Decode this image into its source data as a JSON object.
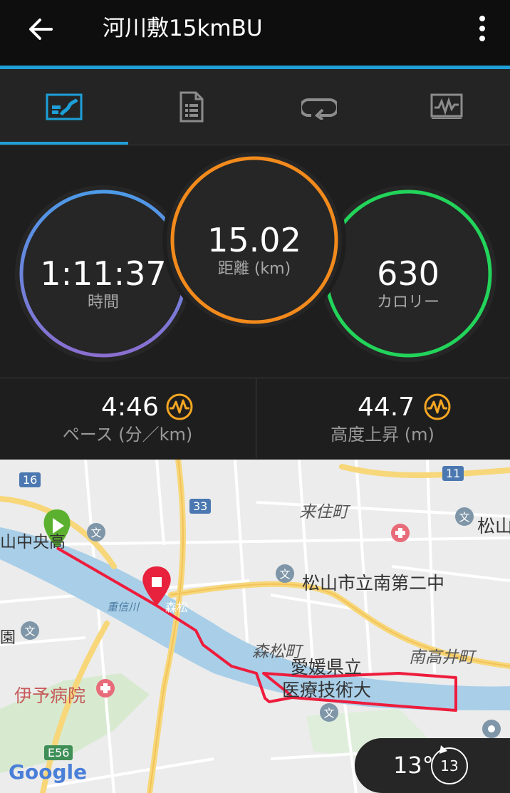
{
  "header": {
    "title": "河川敷15kmBU",
    "back_icon": "arrow-left-icon",
    "menu_icon": "more-vertical-icon"
  },
  "tabs": [
    {
      "name": "stats",
      "icon": "stats-icon",
      "active": true
    },
    {
      "name": "details",
      "icon": "document-icon",
      "active": false
    },
    {
      "name": "laps",
      "icon": "loop-icon",
      "active": false
    },
    {
      "name": "charts",
      "icon": "chart-icon",
      "active": false
    }
  ],
  "rings": {
    "time": {
      "value": "1:11:37",
      "label": "時間"
    },
    "distance": {
      "value": "15.02",
      "label": "距離",
      "unit": "(km)"
    },
    "calories": {
      "value": "630",
      "label": "カロリー"
    }
  },
  "stats": {
    "pace": {
      "value": "4:46",
      "label": "ペース (分／km)"
    },
    "elevation": {
      "value": "44.7",
      "label": "高度上昇 (m)"
    }
  },
  "map": {
    "labels": {
      "kurumicho": "来住町",
      "matsuyama_minami": "松山市立南第二中",
      "morimatsu": "森松町",
      "ehime1": "愛媛県立",
      "ehime2": "医療技術大",
      "minamitakai": "南高井町",
      "iyo_hospital": "伊予病院",
      "matsu": "松山",
      "matsuyama_naka": "山中央高",
      "shigenobu": "重信川",
      "sono": "園",
      "morimatsu_station": "森松",
      "road16": "16",
      "road33": "33",
      "road11": "11",
      "e56": "E56",
      "google": "Google"
    }
  },
  "weather": {
    "temperature": "13°",
    "wind": "13"
  },
  "colors": {
    "accent": "#1e9fd8",
    "time_ring": "#5a8fe0",
    "distance_ring": "#f28a1c",
    "calorie_ring": "#22d45a",
    "route": "#ee1c3c",
    "stat_icon": "#f5a623"
  }
}
